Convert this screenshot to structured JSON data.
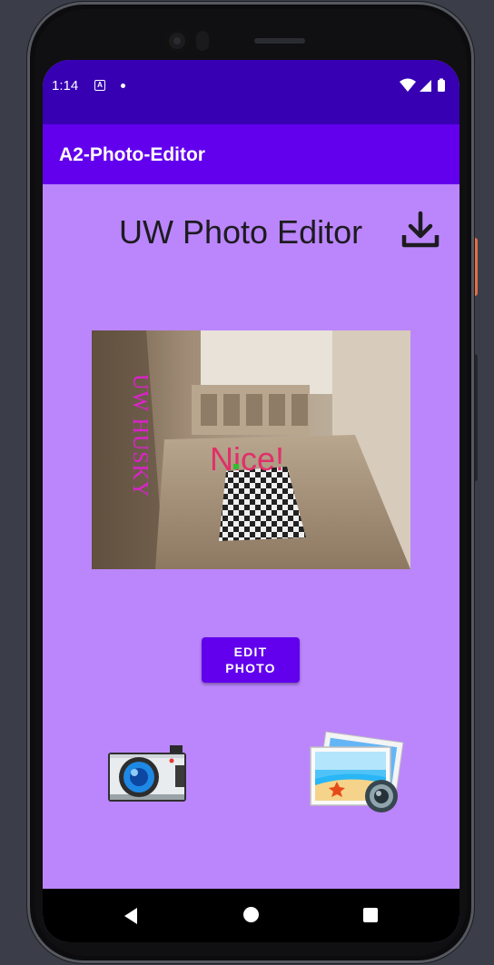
{
  "status": {
    "time": "1:14",
    "notif_badge": "A"
  },
  "app": {
    "title": "A2-Photo-Editor"
  },
  "main": {
    "heading": "UW Photo Editor",
    "photo_overlay": {
      "vertical_text": "UW HUSKY",
      "caption": "Nice!"
    },
    "edit_button": {
      "line1": "EDIT",
      "line2": "PHOTO"
    }
  },
  "icons": {
    "download": "download-icon",
    "camera": "camera-icon",
    "gallery": "gallery-icon"
  },
  "colors": {
    "status_bar": "#3700b3",
    "app_bar": "#6200ee",
    "background": "#bb86fc",
    "button": "#6200ee",
    "overlay_magenta": "#e020d0",
    "overlay_red": "#e0306a"
  }
}
